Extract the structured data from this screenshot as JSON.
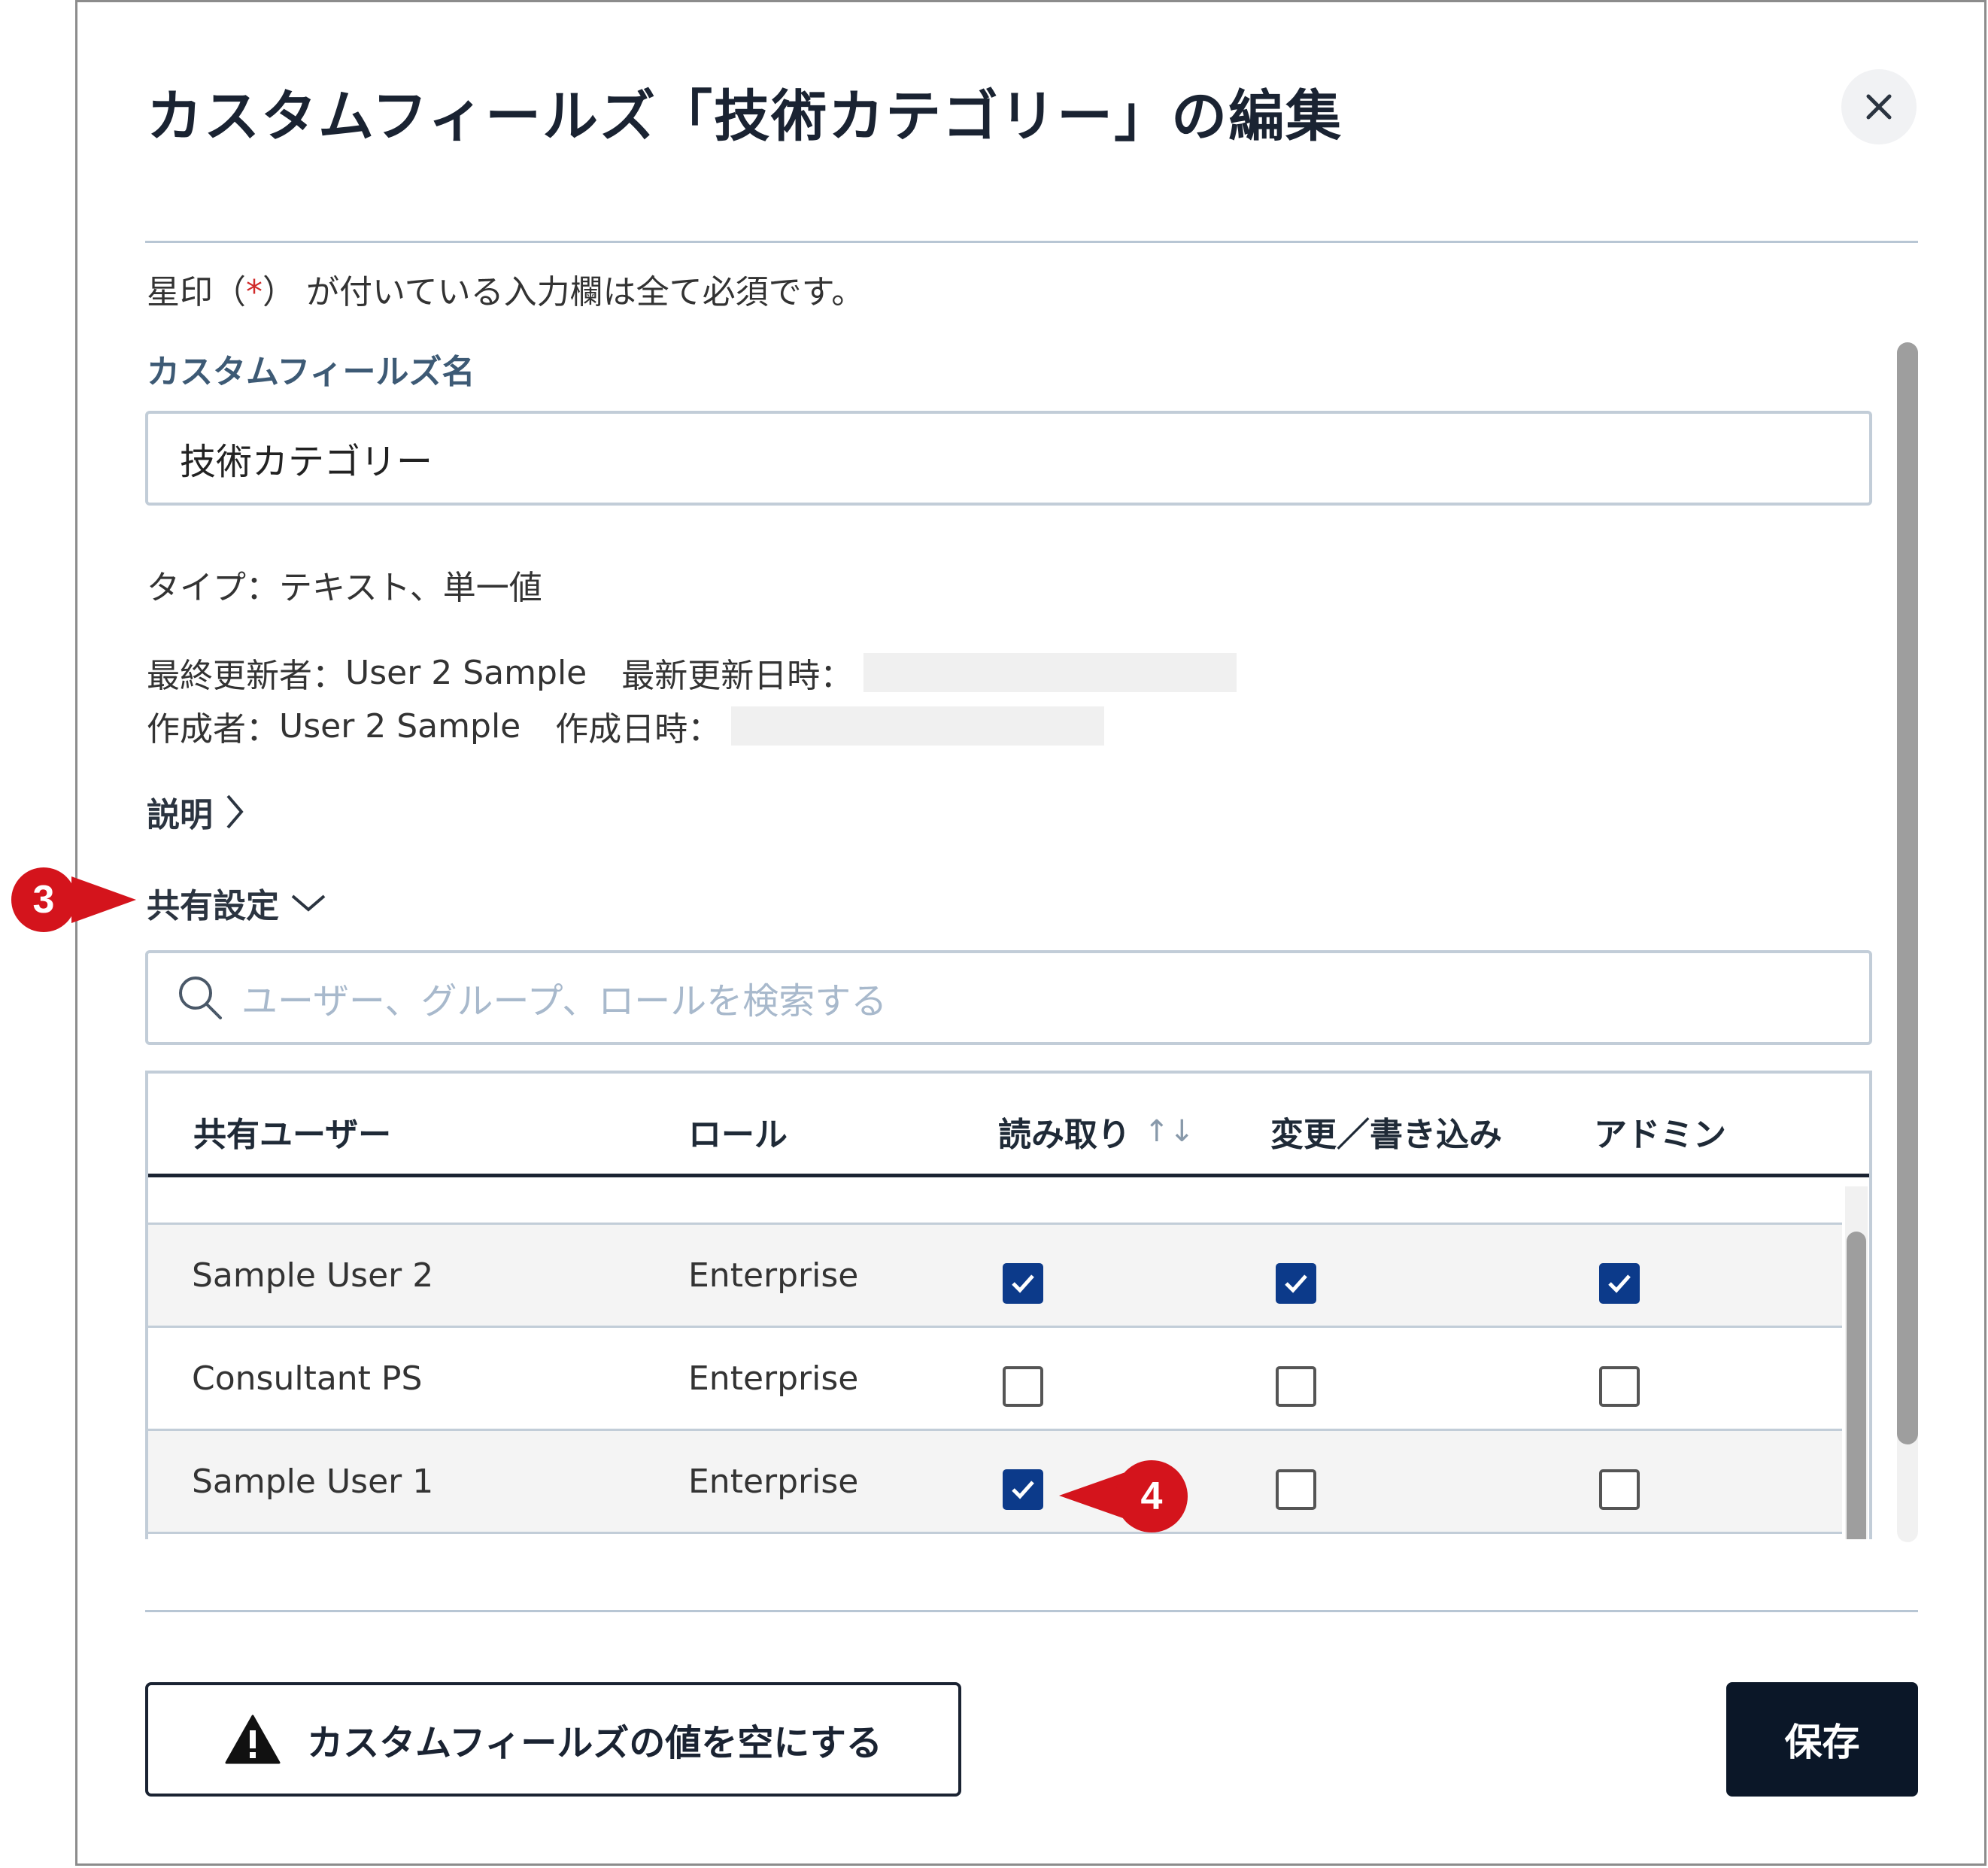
{
  "dialog": {
    "title": "カスタムフィールズ「技術カテゴリー」の編集",
    "close_icon": "×"
  },
  "form": {
    "required_note_pre": "星印（",
    "required_note_ast": "*",
    "required_note_post": "） が付いている入力欄は全て必須です。",
    "name_label": "カスタムフィールズ名",
    "name_value": "技術カテゴリー",
    "type_text": "タイプ：テキスト、単一値",
    "last_updated_by_label": "最終更新者：",
    "last_updated_by": "User 2 Sample",
    "last_updated_at_label": "最新更新日時：",
    "created_by_label": "作成者：",
    "created_by": "User 2 Sample",
    "created_at_label": "作成日時：",
    "description_toggle": "説明",
    "sharing_toggle": "共有設定"
  },
  "callouts": {
    "sharing": "3",
    "read_checkbox": "4"
  },
  "search": {
    "placeholder": "ユーザー、グループ、ロールを検索する"
  },
  "table": {
    "headers": {
      "user": "共有ユーザー",
      "role": "ロール",
      "read": "読み取り",
      "read_sort": "↑↓",
      "write": "変更／書き込み",
      "admin": "アドミン"
    },
    "rows": [
      {
        "user": "Sample User 2",
        "role": "Enterprise",
        "read": true,
        "write": true,
        "admin": true
      },
      {
        "user": "Consultant PS",
        "role": "Enterprise",
        "read": false,
        "write": false,
        "admin": false
      },
      {
        "user": "Sample User 1",
        "role": "Enterprise",
        "read": true,
        "write": false,
        "admin": false
      }
    ]
  },
  "footer": {
    "clear_label": "カスタムフィールズの値を空にする",
    "save_label": "保存"
  },
  "icons": [
    "close-icon",
    "chevron-right-icon",
    "chevron-down-icon",
    "search-icon",
    "sort-icon",
    "check-icon",
    "warning-icon"
  ],
  "colors": {
    "callout": "#d4141c",
    "checkbox_checked": "#0c3a8a",
    "save_button": "#0b1728"
  }
}
